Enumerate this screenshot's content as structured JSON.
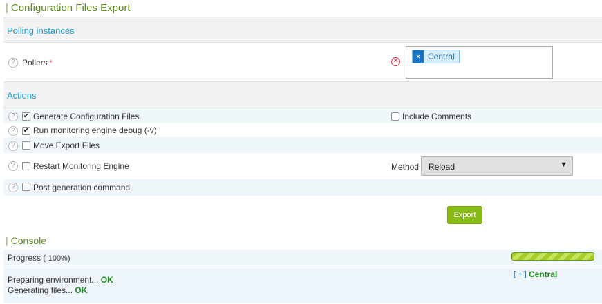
{
  "page_title": "Configuration Files Export",
  "polling": {
    "header": "Polling instances",
    "pollers_label": "Pollers",
    "required_mark": "*",
    "selected": [
      "Central"
    ],
    "chip_remove": "×",
    "help": "?"
  },
  "actions": {
    "header": "Actions",
    "generate": {
      "label": "Generate Configuration Files",
      "checked": true
    },
    "include_comments": {
      "label": "Include Comments",
      "checked": false
    },
    "debug": {
      "label": "Run monitoring engine debug (-v)",
      "checked": true
    },
    "move": {
      "label": "Move Export Files",
      "checked": false
    },
    "restart": {
      "label": "Restart Monitoring Engine",
      "checked": false
    },
    "method_label": "Method",
    "method_value": "Reload",
    "post": {
      "label": "Post generation command",
      "checked": false
    },
    "export_button": "Export",
    "check_glyph": "✔",
    "caret": "▼"
  },
  "console": {
    "title": "Console",
    "progress_label": "Progress (",
    "progress_value": "100%)",
    "progress_fraction": 1.0,
    "lines": [
      {
        "text": "Preparing environment...",
        "status": "OK"
      },
      {
        "text": "Generating files...",
        "status": "OK"
      }
    ],
    "toggle": "[ + ]",
    "poller": "Central"
  },
  "colors": {
    "accent": "#88b917",
    "link": "#1b9bd1",
    "ok": "#1d8a1d"
  }
}
